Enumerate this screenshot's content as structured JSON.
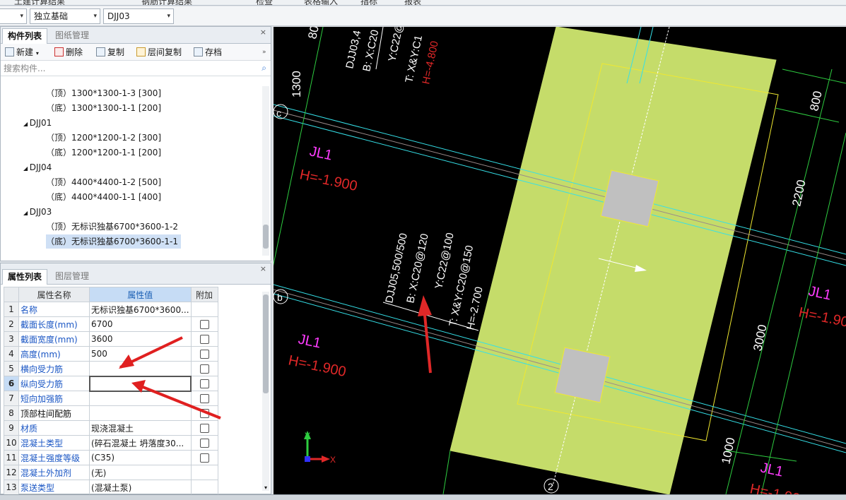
{
  "topbar": {
    "items": [
      "土建计算结果",
      "钢筋计算结果",
      "检查",
      "表格输入",
      "指标",
      "报表"
    ]
  },
  "filters": {
    "combo1": "",
    "combo2": "独立基础",
    "combo3": "DJJ03"
  },
  "component_panel": {
    "tabs": [
      "构件列表",
      "图纸管理"
    ],
    "toolbar": [
      "新建",
      "删除",
      "复制",
      "层间复制",
      "存档"
    ],
    "search_placeholder": "搜索构件...",
    "tree": [
      {
        "label": "（顶）1300*1300-1-3 [300]",
        "level": 2
      },
      {
        "label": "（底）1300*1300-1-1 [200]",
        "level": 2
      },
      {
        "label": "DJJ01",
        "level": 1
      },
      {
        "label": "（顶）1200*1200-1-2 [300]",
        "level": 2
      },
      {
        "label": "（底）1200*1200-1-1 [200]",
        "level": 2
      },
      {
        "label": "DJJ04",
        "level": 1
      },
      {
        "label": "（顶）4400*4400-1-2 [500]",
        "level": 2
      },
      {
        "label": "（底）4400*4400-1-1 [400]",
        "level": 2
      },
      {
        "label": "DJJ03",
        "level": 1
      },
      {
        "label": "（顶）无标识独基6700*3600-1-2",
        "level": 2
      },
      {
        "label": "（底）无标识独基6700*3600-1-1",
        "level": 2,
        "selected": true
      }
    ]
  },
  "property_panel": {
    "tabs": [
      "属性列表",
      "图层管理"
    ],
    "headers": [
      "属性名称",
      "属性值",
      "附加"
    ],
    "rows": [
      {
        "num": "1",
        "name": "名称",
        "value": "无标识独基6700*3600...",
        "color": "blue",
        "chk": false
      },
      {
        "num": "2",
        "name": "截面长度(mm)",
        "value": "6700",
        "color": "blue",
        "chk": true
      },
      {
        "num": "3",
        "name": "截面宽度(mm)",
        "value": "3600",
        "color": "blue",
        "chk": true
      },
      {
        "num": "4",
        "name": "高度(mm)",
        "value": "500",
        "color": "blue",
        "chk": true
      },
      {
        "num": "5",
        "name": "横向受力筋",
        "value": "",
        "color": "blue",
        "chk": true
      },
      {
        "num": "6",
        "name": "纵向受力筋",
        "value": "",
        "color": "blue",
        "chk": true,
        "selected": true
      },
      {
        "num": "7",
        "name": "短向加强筋",
        "value": "",
        "color": "blue",
        "chk": true
      },
      {
        "num": "8",
        "name": "顶部柱间配筋",
        "value": "",
        "color": "black",
        "chk": true
      },
      {
        "num": "9",
        "name": "材质",
        "value": "现浇混凝土",
        "color": "blue",
        "chk": true
      },
      {
        "num": "10",
        "name": "混凝土类型",
        "value": "(碎石混凝土 坍落度30...",
        "color": "blue",
        "chk": true
      },
      {
        "num": "11",
        "name": "混凝土强度等级",
        "value": "(C35)",
        "color": "blue",
        "chk": true
      },
      {
        "num": "12",
        "name": "混凝土外加剂",
        "value": "(无)",
        "color": "blue",
        "chk": false
      },
      {
        "num": "13",
        "name": "泵送类型",
        "value": "(混凝土泵)",
        "color": "blue",
        "chk": false
      }
    ]
  },
  "drawing": {
    "dim_texts": [
      "1300",
      "800",
      "2200",
      "3000",
      "1000",
      "80"
    ],
    "axis_labels": [
      "c",
      "b",
      "2"
    ],
    "beam_labels": [
      "JL1",
      "H=-1.900"
    ],
    "footing_note_top": [
      "DJJ03,4",
      "B: X:C20",
      "Y:C22@",
      "T: X&Y:C1",
      "H=-4.800"
    ],
    "footing_note_main": [
      "DJJ05,500/500",
      "B: X:C20@120",
      "Y:C22@100",
      "T: X&Y:C20@150",
      "H=-2.700"
    ],
    "ucs": {
      "x": "X",
      "y": "Y"
    },
    "colors": {
      "footing_fill": "#c5dc6a",
      "column": "#c0c0c0",
      "cyan": "#35e0e8",
      "magenta": "#ff3cff",
      "red": "#e02828",
      "green": "#2ecc40",
      "background": "#000000"
    }
  }
}
